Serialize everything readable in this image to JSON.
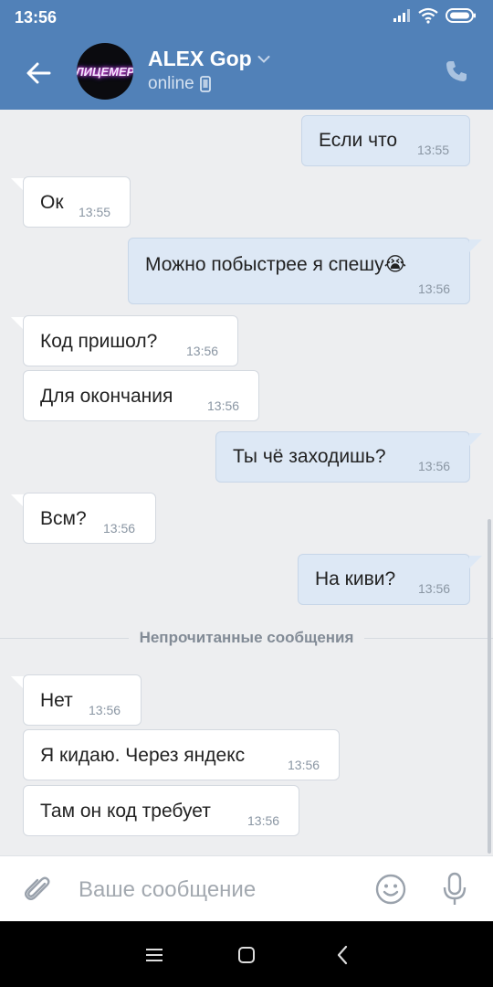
{
  "status_bar": {
    "time": "13:56"
  },
  "header": {
    "avatar_text": "ЛИЦЕМЕР",
    "name": "ALEX Gop",
    "status": "online"
  },
  "messages": [
    {
      "dir": "out",
      "text": "Если что",
      "time": "13:55"
    },
    {
      "dir": "in",
      "text": "Ок",
      "time": "13:55"
    },
    {
      "dir": "out",
      "text": "Можно побыстрее я спешу😭",
      "time": "13:56"
    },
    {
      "dir": "in",
      "text": "Код пришол?",
      "time": "13:56"
    },
    {
      "dir": "in",
      "text": "Для окончания",
      "time": "13:56"
    },
    {
      "dir": "out",
      "text": "Ты чё заходишь?",
      "time": "13:56"
    },
    {
      "dir": "in",
      "text": "Всм?",
      "time": "13:56"
    },
    {
      "dir": "out",
      "text": "На киви?",
      "time": "13:56"
    },
    {
      "dir": "in",
      "text": "Нет",
      "time": "13:56"
    },
    {
      "dir": "in",
      "text": "Я кидаю. Через яндекс",
      "time": "13:56"
    },
    {
      "dir": "in",
      "text": "Там он код требует",
      "time": "13:56"
    }
  ],
  "divider": {
    "label": "Непрочитанные сообщения"
  },
  "composer": {
    "placeholder": "Ваше сообщение"
  },
  "icons": {
    "back": "arrow-left-icon",
    "call": "phone-icon",
    "attach": "paperclip-icon",
    "emoji": "smiley-icon",
    "mic": "microphone-icon"
  },
  "colors": {
    "header": "#5181b8",
    "outgoing_bubble": "#dde8f5",
    "incoming_bubble": "#ffffff",
    "chat_background": "#edeef0"
  }
}
